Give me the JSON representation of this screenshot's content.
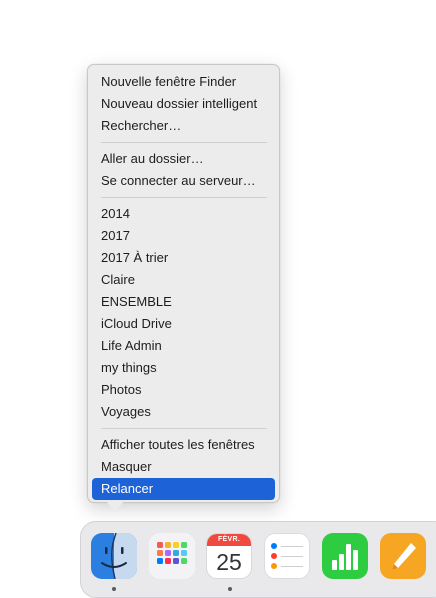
{
  "context_menu": {
    "items_group1": [
      "Nouvelle fenêtre Finder",
      "Nouveau dossier intelligent",
      "Rechercher…"
    ],
    "items_group2": [
      "Aller au dossier…",
      "Se connecter au serveur…"
    ],
    "recent_folders": [
      "2014",
      "2017",
      "2017 À trier",
      "Claire",
      "ENSEMBLE",
      "iCloud Drive",
      "Life Admin",
      "my things",
      "Photos",
      "Voyages"
    ],
    "items_group3": [
      "Afficher toutes les fenêtres",
      "Masquer",
      "Relancer"
    ],
    "highlighted_item": "Relancer"
  },
  "dock": {
    "apps": [
      {
        "name": "Finder",
        "icon": "finder-icon",
        "running": true
      },
      {
        "name": "Launchpad",
        "icon": "launchpad-icon",
        "running": false
      },
      {
        "name": "Calendrier",
        "icon": "calendar-icon",
        "running": true,
        "month": "FÉVR.",
        "day": "25"
      },
      {
        "name": "Rappels",
        "icon": "reminders-icon",
        "running": false
      },
      {
        "name": "Numbers",
        "icon": "numbers-icon",
        "running": false
      },
      {
        "name": "Pages",
        "icon": "pages-icon",
        "running": false
      }
    ]
  },
  "colors": {
    "highlight": "#1e62d8",
    "menu_bg": "#ececec",
    "calendar_red": "#f04a3f",
    "numbers_green": "#2ecc40",
    "pages_orange": "#f6a623"
  }
}
